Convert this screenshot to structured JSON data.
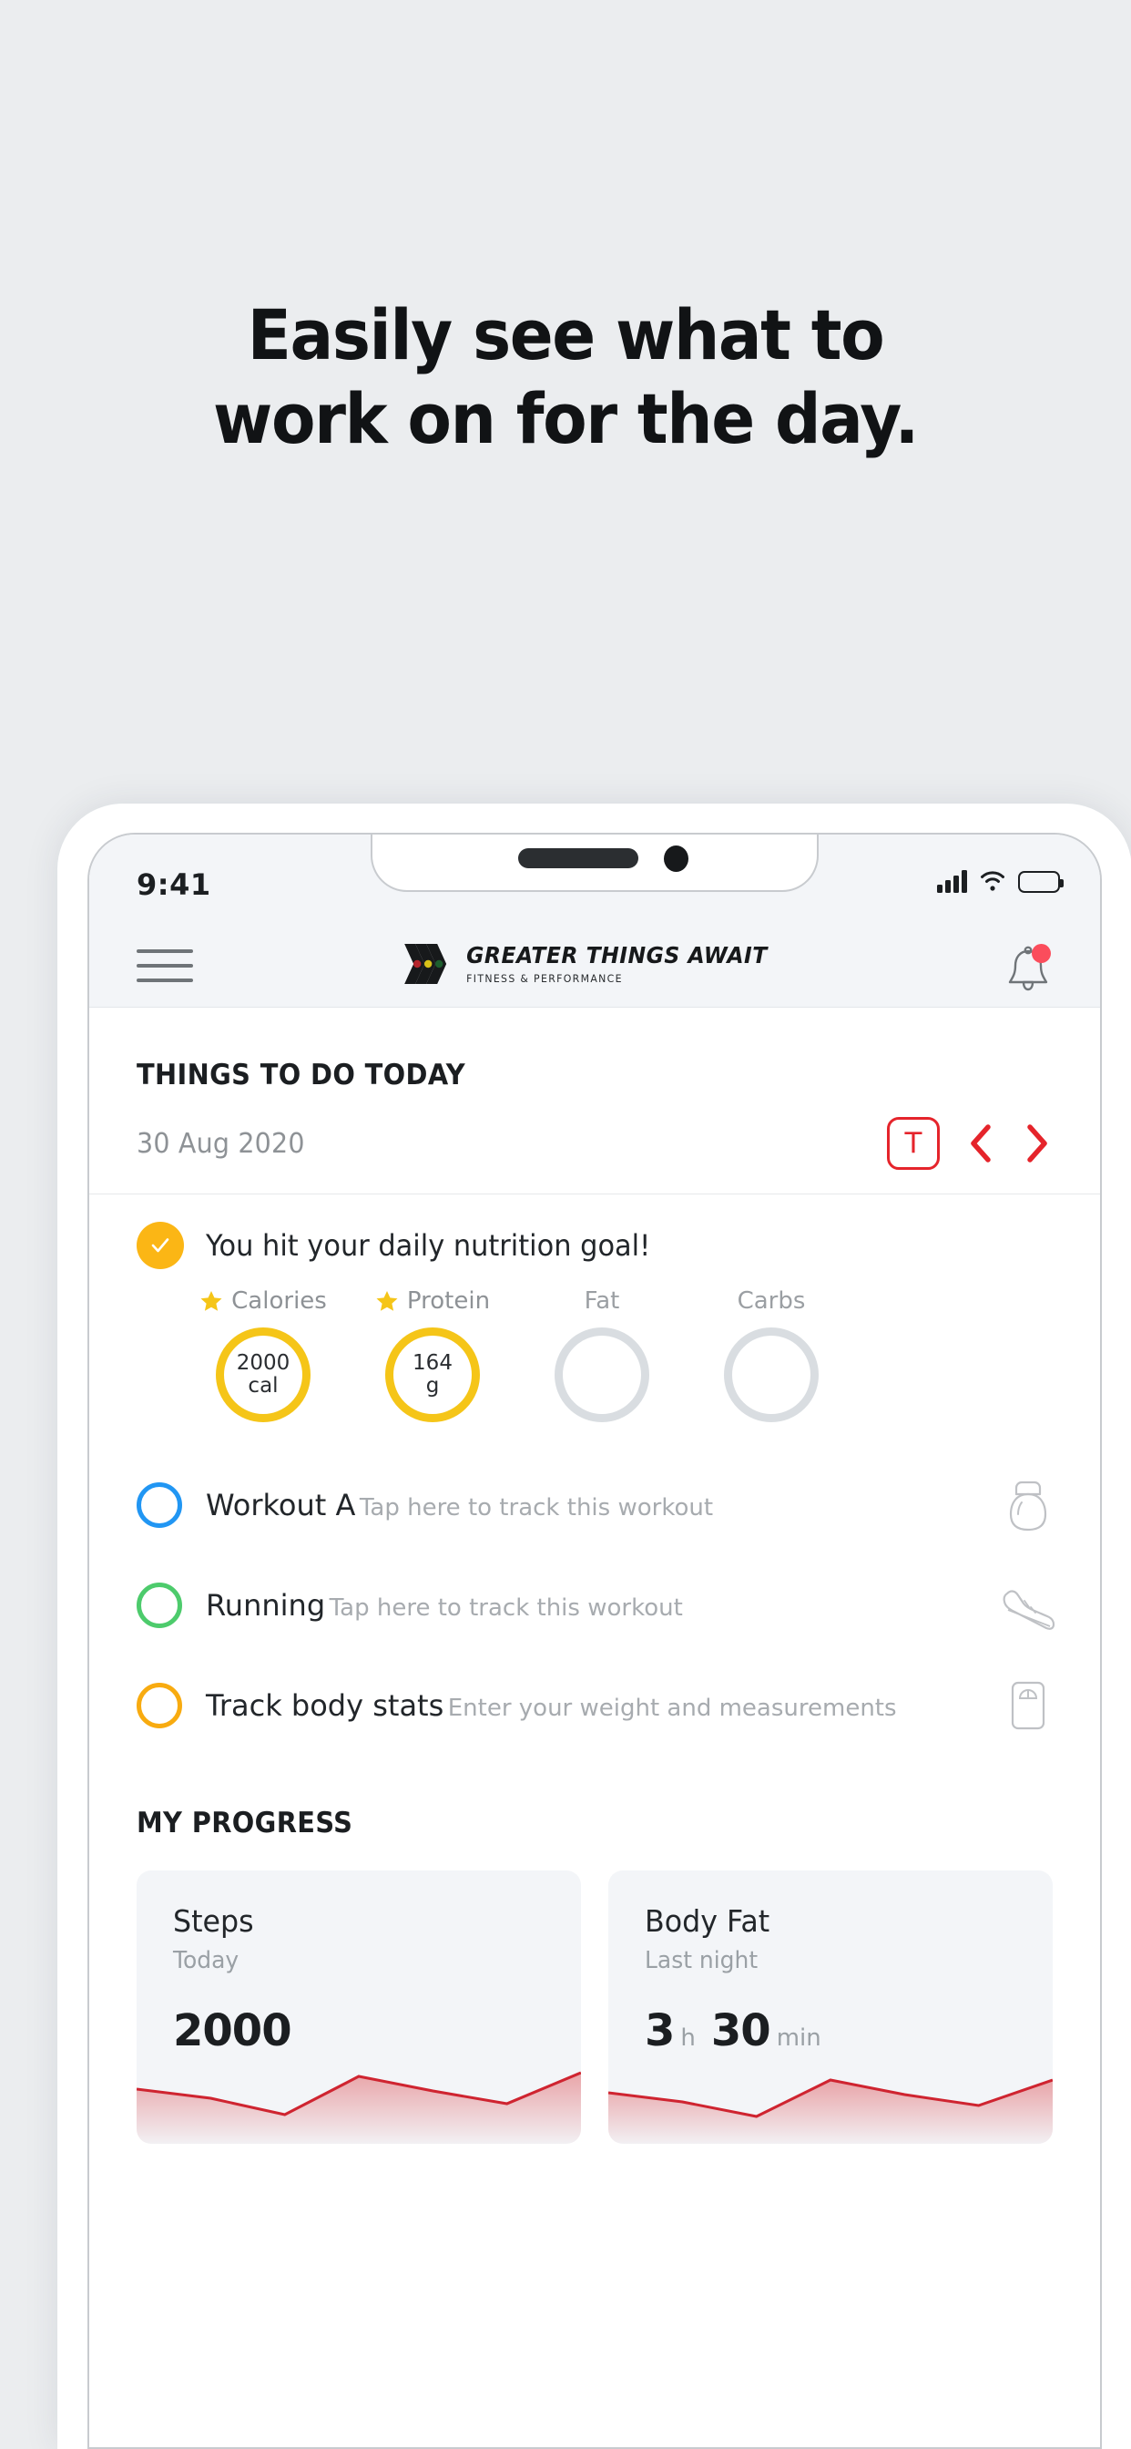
{
  "marketing": {
    "headline_line1": "Easily see what to",
    "headline_line2": "work on for the day."
  },
  "status_bar": {
    "time": "9:41",
    "signal_icon": "cellular-signal-icon",
    "wifi_icon": "wifi-icon",
    "battery_icon": "battery-full-icon"
  },
  "app_header": {
    "menu_icon": "hamburger-menu-icon",
    "brand_name": "GREATER THINGS AWAIT",
    "brand_tagline": "FITNESS & PERFORMANCE",
    "brand_mark_icon": "chevron-arrows-logo-icon",
    "notifications_icon": "bell-icon",
    "notification_badge_color": "#fb4d5c"
  },
  "todo": {
    "section_title": "THINGS TO DO TODAY",
    "date": "30 Aug 2020",
    "today_button_label": "T",
    "prev_icon": "chevron-left-icon",
    "next_icon": "chevron-right-icon",
    "accent_color": "#e5242b"
  },
  "nutrition": {
    "check_icon": "check-circle-icon",
    "message": "You hit your daily nutrition goal!",
    "goal_color": "#f5c518",
    "empty_color": "#d9dde1",
    "macros": [
      {
        "label": "Calories",
        "starred": true,
        "value": "2000",
        "unit": "cal",
        "complete": true
      },
      {
        "label": "Protein",
        "starred": true,
        "value": "164",
        "unit": "g",
        "complete": true
      },
      {
        "label": "Fat",
        "starred": false,
        "value": "",
        "unit": "",
        "complete": false
      },
      {
        "label": "Carbs",
        "starred": false,
        "value": "",
        "unit": "",
        "complete": false
      }
    ]
  },
  "tasks": [
    {
      "title": "Workout A",
      "subtitle": "Tap here to track this workout",
      "circle_color": "#2196f3",
      "icon": "kettlebell-icon"
    },
    {
      "title": "Running",
      "subtitle": "Tap here to track this workout",
      "circle_color": "#4dcb6c",
      "icon": "running-shoe-icon"
    },
    {
      "title": "Track body stats",
      "subtitle": "Enter your weight and measurements",
      "circle_color": "#f8ab10",
      "icon": "weight-scale-icon"
    }
  ],
  "progress": {
    "section_title": "MY PROGRESS",
    "cards": [
      {
        "title": "Steps",
        "subtitle": "Today",
        "value": "2000",
        "unit": "",
        "value2": "",
        "unit2": ""
      },
      {
        "title": "Body Fat",
        "subtitle": "Last night",
        "value": "3",
        "unit": "h",
        "value2": "30",
        "unit2": "min"
      }
    ]
  },
  "chart_data": [
    {
      "type": "area",
      "title": "Steps",
      "x": [
        0,
        1,
        2,
        3,
        4,
        5,
        6
      ],
      "values": [
        46,
        38,
        24,
        56,
        44,
        34,
        58
      ],
      "line_color": "#cf2430",
      "fill_color": "#e8a0a4",
      "grid": false,
      "xlabel": "",
      "ylabel": "",
      "ylim": [
        0,
        70
      ]
    },
    {
      "type": "area",
      "title": "Body Fat",
      "x": [
        0,
        1,
        2,
        3,
        4,
        5,
        6
      ],
      "values": [
        44,
        34,
        26,
        54,
        40,
        32,
        54
      ],
      "line_color": "#cf2430",
      "fill_color": "#e8a0a4",
      "grid": false,
      "xlabel": "",
      "ylabel": "",
      "ylim": [
        0,
        70
      ]
    }
  ]
}
